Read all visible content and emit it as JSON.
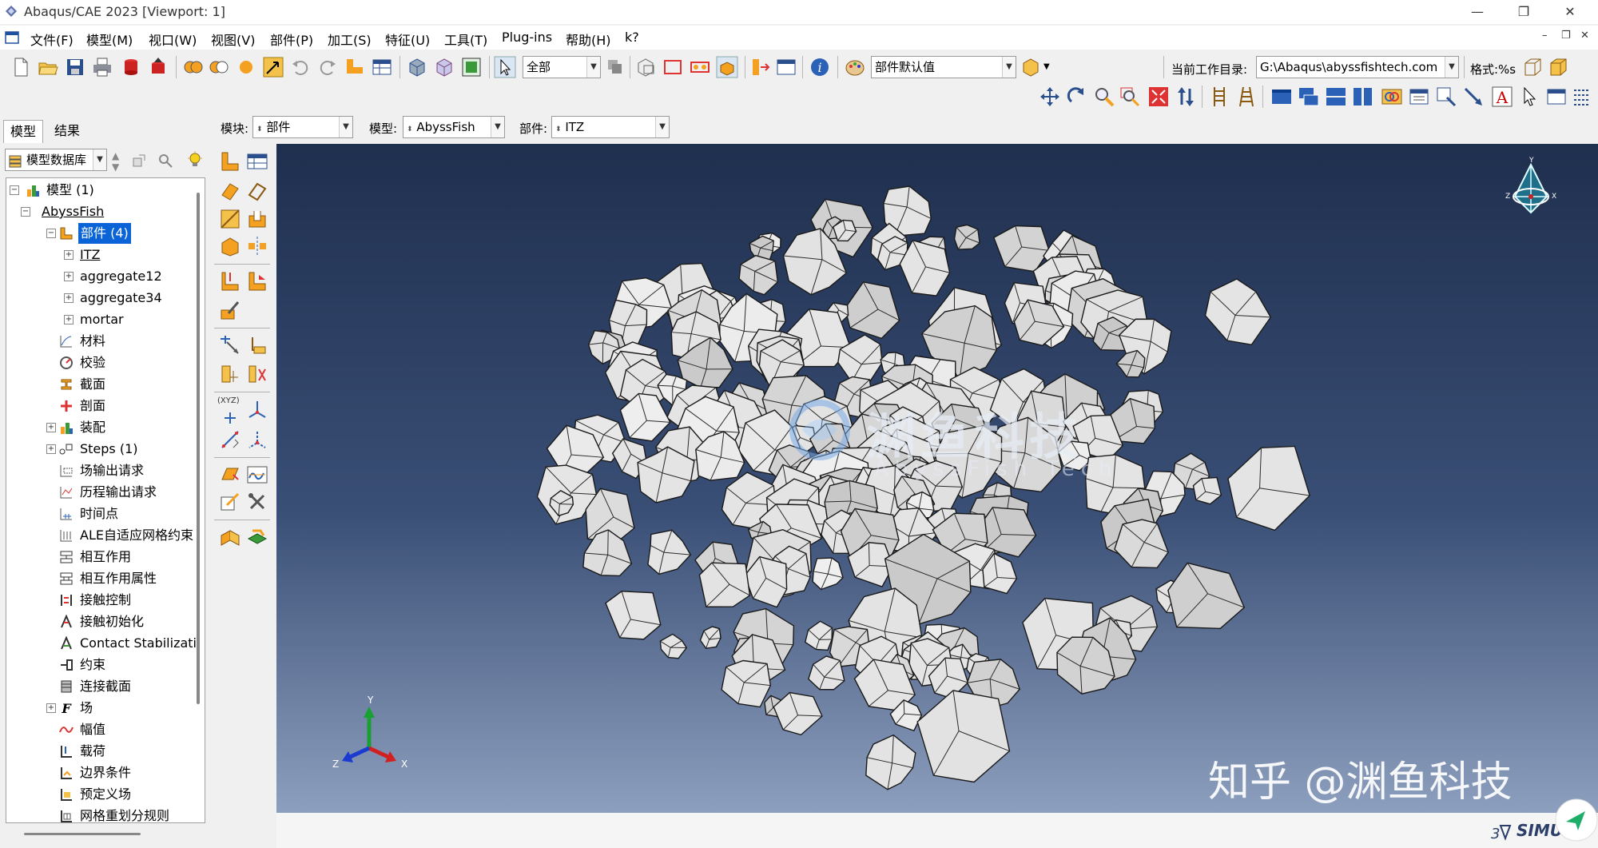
{
  "window": {
    "title": "Abaqus/CAE 2023 [Viewport: 1]",
    "controls": [
      "—",
      "❐",
      "✕"
    ]
  },
  "menubar": {
    "items": [
      "文件(F)",
      "模型(M)",
      "视口(W)",
      "视图(V)",
      "部件(P)",
      "加工(S)",
      "特征(U)",
      "工具(T)",
      "Plug-ins",
      "帮助(H)",
      "k?"
    ],
    "mdi_controls": [
      "–",
      "❐",
      "✕"
    ]
  },
  "toolbar": {
    "selection_filter": "全部",
    "render_style": "部件默认值",
    "workdir_label": "当前工作目录:",
    "workdir_value": "G:\\Abaqus\\abyssfishtech.com",
    "format_label": "格式:%s",
    "info_icon": "i"
  },
  "context": {
    "module_label": "模块:",
    "module_value": "部件",
    "model_label": "模型:",
    "model_value": "AbyssFish",
    "part_label": "部件:",
    "part_value": "ITZ"
  },
  "leftpanel": {
    "tabs": [
      "模型",
      "结果"
    ],
    "db_selector": "模型数据库"
  },
  "tree": {
    "root": "模型 (1)",
    "model": "AbyssFish",
    "parts_node": "部件 (4)",
    "parts": [
      "ITZ",
      "aggregate12",
      "aggregate34",
      "mortar"
    ],
    "items": [
      "材料",
      "校验",
      "截面",
      "剖面",
      "装配",
      "Steps (1)",
      "场输出请求",
      "历程输出请求",
      "时间点",
      "ALE自适应网格约束",
      "相互作用",
      "相互作用属性",
      "接触控制",
      "接触初始化",
      "Contact Stabilizati",
      "约束",
      "连接截面",
      "场",
      "幅值",
      "载荷",
      "边界条件",
      "预定义场",
      "网格重划分规则"
    ]
  },
  "viewport": {
    "triad_labels": [
      "Y",
      "Z",
      "X"
    ],
    "view_cube_labels": [
      "Y",
      "Z",
      "X"
    ],
    "watermark_cn": "渊鱼科技",
    "watermark_en": "AbyssFish Tech",
    "watermark_zhihu": "知乎 @渊鱼科技",
    "brand_fragment": "SIMU"
  },
  "colors": {
    "selection": "#0a64d8",
    "viewport_top": "#1f2f4e",
    "viewport_bottom": "#8d9fbe",
    "particle_fill": "#e4e4e4"
  }
}
